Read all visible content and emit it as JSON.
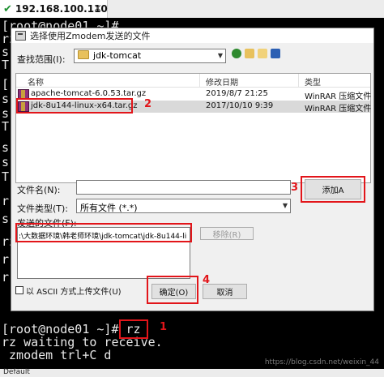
{
  "tab": {
    "title": "192.168.100.110",
    "close_glyph": "×",
    "check_glyph": "✔"
  },
  "terminal": {
    "lines": [
      "[root@node01 ~]#",
      "rz",
      "s",
      "T",
      "[",
      "s",
      "s",
      "T",
      "s",
      "s",
      "T",
      "r",
      "s",
      "rz",
      "r",
      "r"
    ],
    "prompt_line": "[root@node01 ~]# ",
    "command": "rz",
    "receive_line": "rz waiting to receive.",
    "zmodem_line": " zmodem trl+C d"
  },
  "dialog": {
    "title": "选择使用Zmodem发送的文件",
    "look_in_label": "查找范围(I):",
    "look_in_value": "jdk-tomcat",
    "columns": {
      "name": "名称",
      "modified": "修改日期",
      "type": "类型"
    },
    "files": [
      {
        "name": "apache-tomcat-6.0.53.tar.gz",
        "modified": "2019/8/7 21:25",
        "type": "WinRAR 压缩文件"
      },
      {
        "name": "jdk-8u144-linux-x64.tar.gz",
        "modified": "2017/10/10 9:39",
        "type": "WinRAR 压缩文件"
      }
    ],
    "filename_label": "文件名(N):",
    "filename_value": "",
    "filetype_label": "文件类型(T):",
    "filetype_value": "所有文件 (*.*)",
    "add_button": "添加A",
    "send_files_label": "发送的文件(F):",
    "send_files_value": ":\\大数据环境\\韩老师环境\\jdk-tomcat\\jdk-8u144-linux-x6",
    "remove_button": "移除(R)",
    "ascii_label": "以 ASCII 方式上传文件(U)",
    "ok_button": "确定(O)",
    "cancel_button": "取消"
  },
  "annotations": [
    "1",
    "2",
    "3",
    "4"
  ],
  "status": {
    "text": "Default"
  },
  "watermark": "https://blog.csdn.net/weixin_44"
}
